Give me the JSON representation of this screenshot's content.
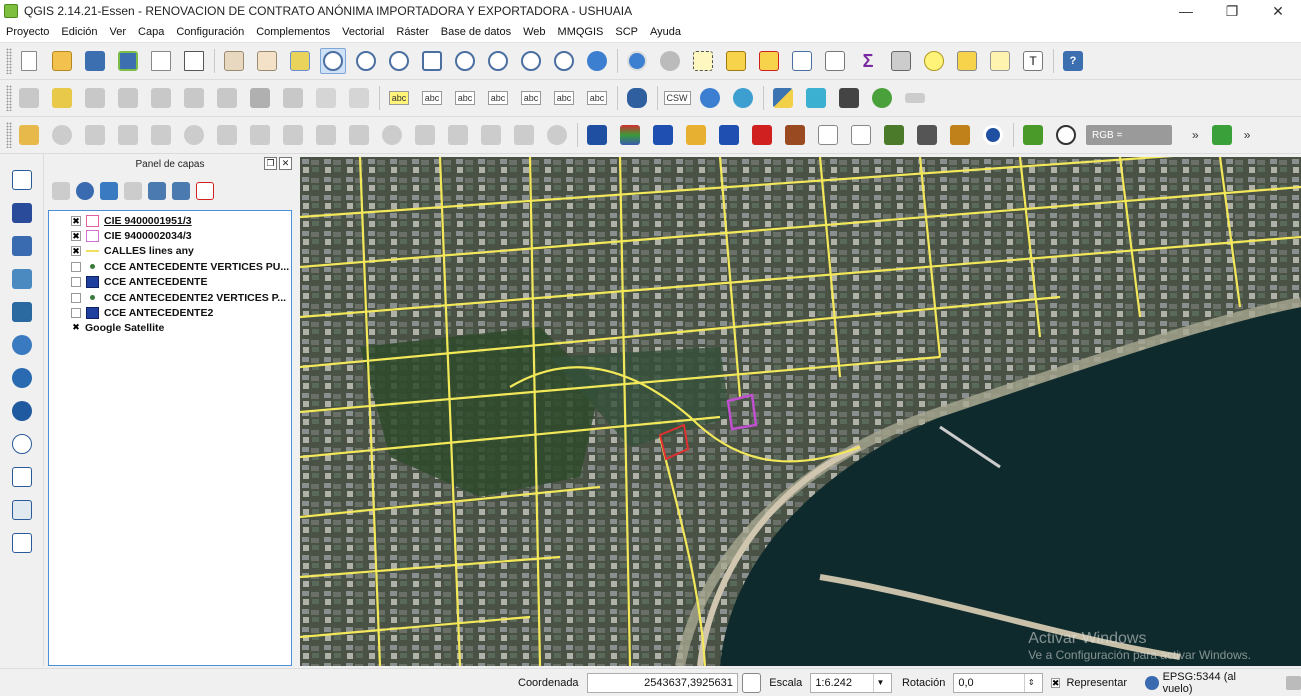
{
  "window": {
    "title": "QGIS 2.14.21-Essen - RENOVACION DE CONTRATO ANÓNIMA IMPORTADORA Y EXPORTADORA - USHUAIA",
    "minimize_glyph": "—",
    "maximize_glyph": "❐",
    "close_glyph": "✕"
  },
  "menu": [
    "Proyecto",
    "Edición",
    "Ver",
    "Capa",
    "Configuración",
    "Complementos",
    "Vectorial",
    "Ráster",
    "Base de datos",
    "Web",
    "MMQGIS",
    "SCP",
    "Ayuda"
  ],
  "toolbar": {
    "abc_label": "abc",
    "csw_label": "CSW",
    "rgb_label": "RGB =",
    "overflow_glyph": "»"
  },
  "panel": {
    "title": "Panel de capas",
    "float_glyph": "❐",
    "close_glyph": "✕"
  },
  "layers": [
    {
      "name": "CIE 9400001951/3",
      "checked": true,
      "symbol": "square-outline",
      "color": "#e060a0"
    },
    {
      "name": "CIE 9400002034/3",
      "checked": true,
      "symbol": "square-outline",
      "color": "#d070d0"
    },
    {
      "name": "CALLES lines any",
      "checked": true,
      "symbol": "line",
      "color": "#f0e060"
    },
    {
      "name": "CCE ANTECEDENTE VERTICES PU...",
      "checked": false,
      "symbol": "dot",
      "color": "#3a7a3a"
    },
    {
      "name": "CCE ANTECEDENTE",
      "checked": false,
      "symbol": "square-fill",
      "color": "#1f3f9f"
    },
    {
      "name": "CCE ANTECEDENTE2 VERTICES P...",
      "checked": false,
      "symbol": "dot",
      "color": "#3a7a3a"
    },
    {
      "name": "CCE ANTECEDENTE2",
      "checked": false,
      "symbol": "square-fill",
      "color": "#1f3f9f"
    },
    {
      "name": "Google Satellite",
      "checked": true,
      "symbol": "none",
      "color": ""
    }
  ],
  "map": {
    "watermark_title": "Activar Windows",
    "watermark_sub": "Ve a Configuración para activar Windows."
  },
  "status": {
    "coord_label": "Coordenada",
    "coord_value": "2543637,3925631",
    "scale_label": "Escala",
    "scale_value": "1:6.242",
    "rotation_label": "Rotación",
    "rotation_value": "0,0",
    "render_label": "Representar",
    "render_checked": "✖",
    "crs_label": "EPSG:5344 (al vuelo)"
  },
  "colors": {
    "streets": "#f2e85a",
    "parcel_red": "#e03030",
    "parcel_purple": "#c050d0",
    "water": "#0f2a2c",
    "accent_selection": "#4a8fd8"
  }
}
